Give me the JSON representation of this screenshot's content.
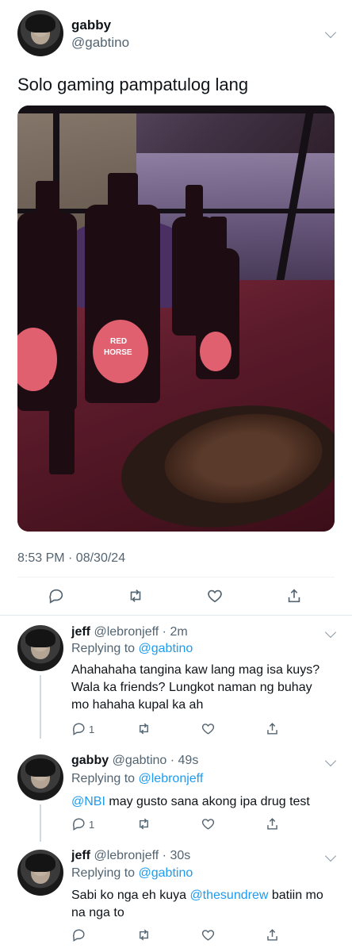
{
  "main_tweet": {
    "display_name": "gabby",
    "handle": "@gabtino",
    "text": "Solo gaming pampatulog lang",
    "timestamp": "8:53 PM · 08/30/24",
    "photo_caption_marks": [
      "RED",
      "HORSE"
    ]
  },
  "replies": [
    {
      "display_name": "jeff",
      "meta": "@lebronjeff · 2m",
      "replying_prefix": "Replying to ",
      "replying_to": "@gabtino",
      "text": "Ahahahaha tangina kaw lang mag isa kuys? Wala ka friends? Lungkot naman ng buhay mo hahaha kupal ka ah",
      "reply_count": "1"
    },
    {
      "display_name": "gabby",
      "meta": "@gabtino · 49s",
      "replying_prefix": "Replying to ",
      "replying_to": "@lebronjeff",
      "mention": "@NBI",
      "text": " may gusto sana akong ipa drug test",
      "reply_count": "1"
    },
    {
      "display_name": "jeff",
      "meta": "@lebronjeff · 30s",
      "replying_prefix": "Replying to ",
      "replying_to": "@gabtino",
      "text_before": "Sabi ko nga eh kuya ",
      "mention": "@thesundrew",
      "text_after": " batiin mo na nga to"
    }
  ],
  "icons": {
    "reply": "reply-icon",
    "retweet": "retweet-icon",
    "like": "heart-icon",
    "share": "share-icon",
    "more": "chevron-down-icon"
  },
  "colors": {
    "link": "#1d9bf0",
    "muted": "#536471",
    "text": "#0f1419"
  }
}
